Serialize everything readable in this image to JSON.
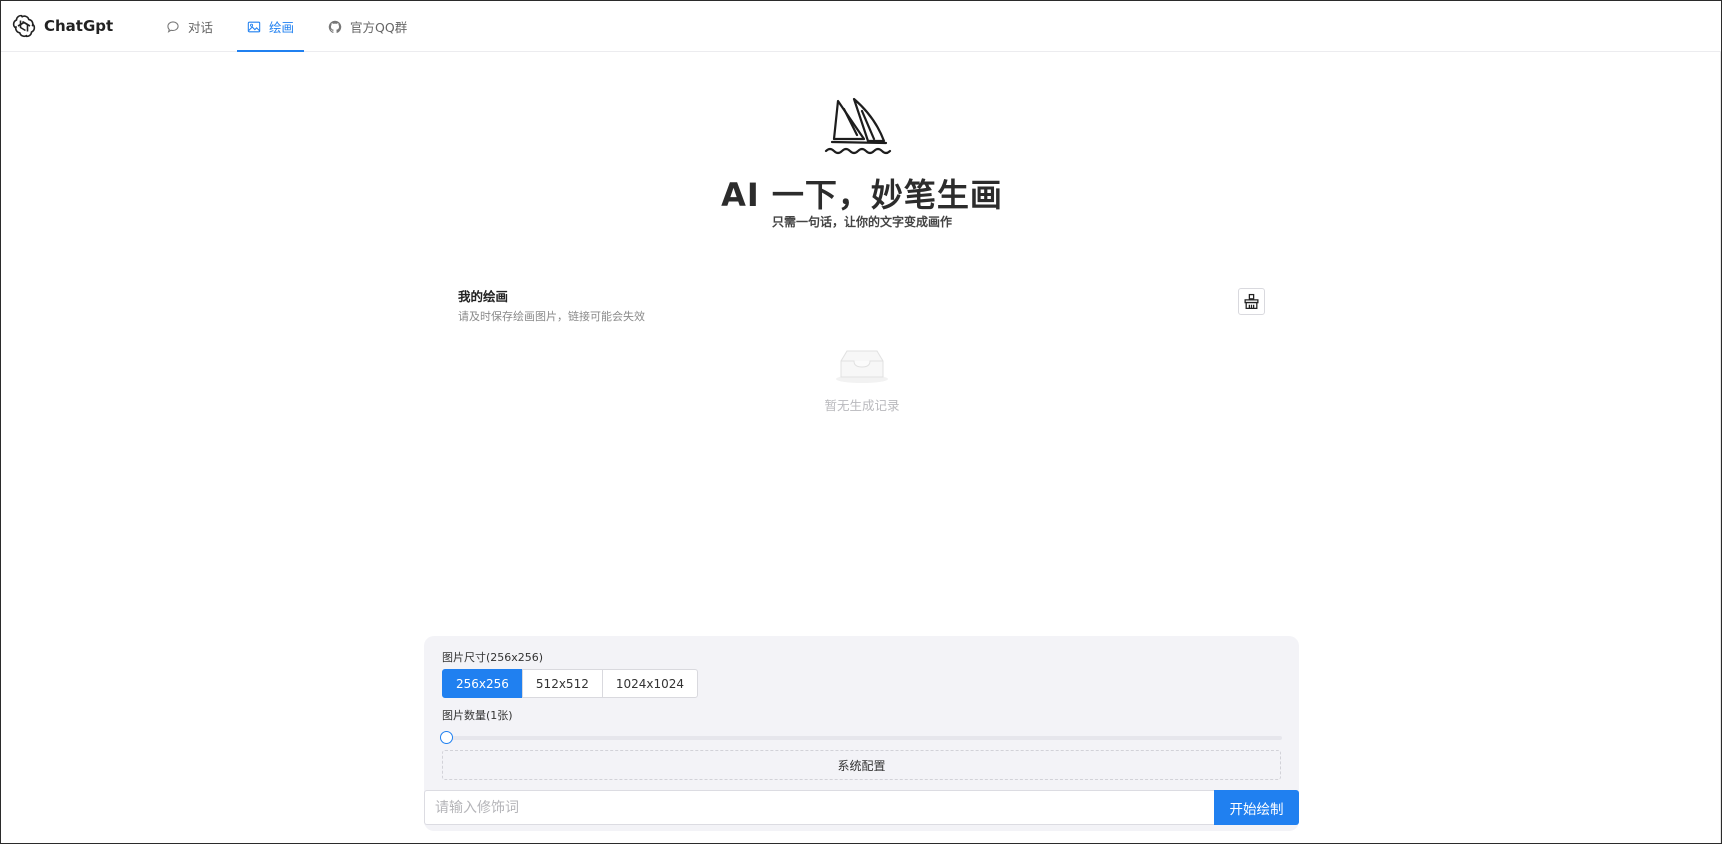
{
  "header": {
    "brand": "ChatGpt",
    "nav": [
      {
        "label": "对话",
        "icon": "chat-bubble-icon"
      },
      {
        "label": "绘画",
        "icon": "image-icon",
        "active": true
      },
      {
        "label": "官方QQ群",
        "icon": "github-icon"
      }
    ]
  },
  "hero": {
    "icon": "sailboat-icon",
    "title": "AI 一下，妙笔生画",
    "subtitle": "只需一句话，让你的文字变成画作"
  },
  "gallery": {
    "title": "我的绘画",
    "description": "请及时保存绘画图片，链接可能会失效",
    "clear_icon": "broom-icon",
    "empty_icon": "inbox-icon",
    "empty_text": "暂无生成记录"
  },
  "config": {
    "size_label": "图片尺寸(256x256)",
    "sizes": [
      "256x256",
      "512x512",
      "1024x1024"
    ],
    "selected_size": "256x256",
    "count_label": "图片数量(1张)",
    "count": {
      "value": 1,
      "min": 1,
      "max": 10
    },
    "system_config_label": "系统配置"
  },
  "prompt": {
    "placeholder": "请输入修饰词",
    "value": "",
    "submit_label": "开始绘制"
  },
  "colors": {
    "accent": "#2080f0",
    "panel_bg": "#f3f3f7"
  }
}
